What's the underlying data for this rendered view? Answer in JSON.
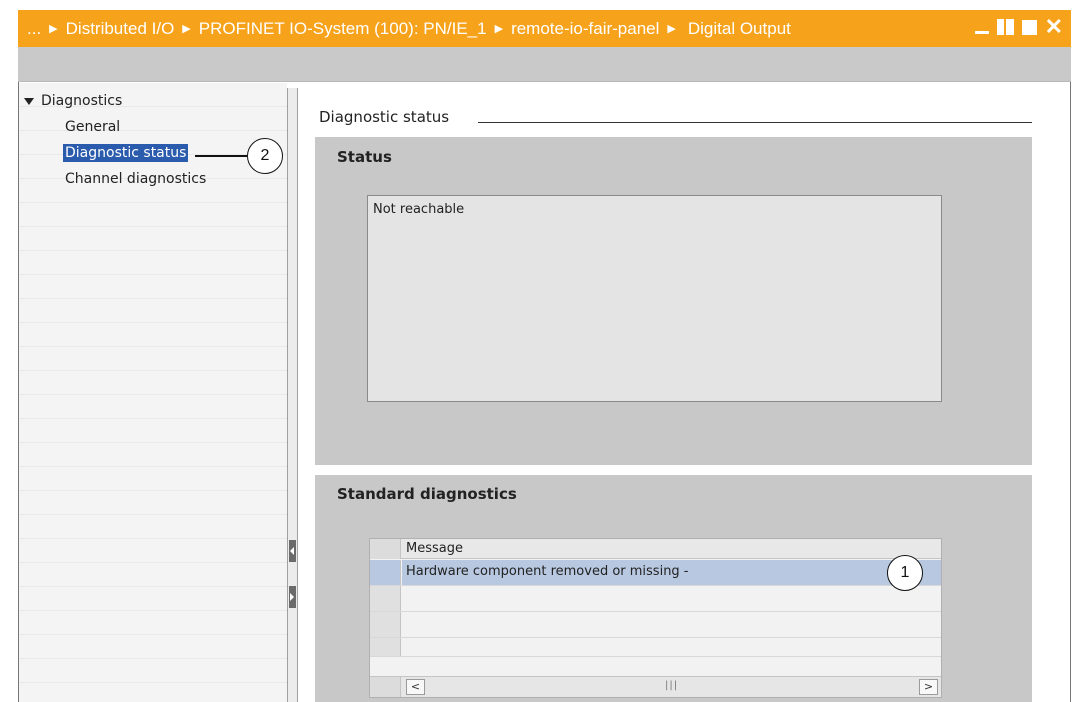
{
  "titlebar": {
    "crumbs": [
      "...",
      "Distributed I/O",
      "PROFINET IO-System (100): PN/IE_1",
      "remote-io-fair-panel",
      "Digital Output"
    ],
    "bg_color": "#f7a21b"
  },
  "tree": {
    "root_label": "Diagnostics",
    "items": [
      {
        "label": "General",
        "selected": false
      },
      {
        "label": "Diagnostic status",
        "selected": true
      },
      {
        "label": "Channel diagnostics",
        "selected": false
      }
    ],
    "selected_color": "#2a5bad"
  },
  "main": {
    "section_title": "Diagnostic status",
    "status_group": {
      "title": "Status",
      "value": "Not reachable"
    },
    "standard_group": {
      "title": "Standard diagnostics",
      "table": {
        "columns": [
          "Message"
        ],
        "rows": [
          {
            "message": "Hardware component removed or missing -",
            "selected": true
          },
          {
            "message": "",
            "selected": false
          },
          {
            "message": "",
            "selected": false
          },
          {
            "message": "",
            "selected": false
          }
        ]
      }
    }
  },
  "callouts": {
    "one": "1",
    "two": "2"
  },
  "icons": [
    "chevron-right-icon",
    "minimize-icon",
    "tile-icon",
    "maximize-icon",
    "close-icon",
    "expand-triangle-icon",
    "scroll-left-icon",
    "scroll-right-icon"
  ]
}
